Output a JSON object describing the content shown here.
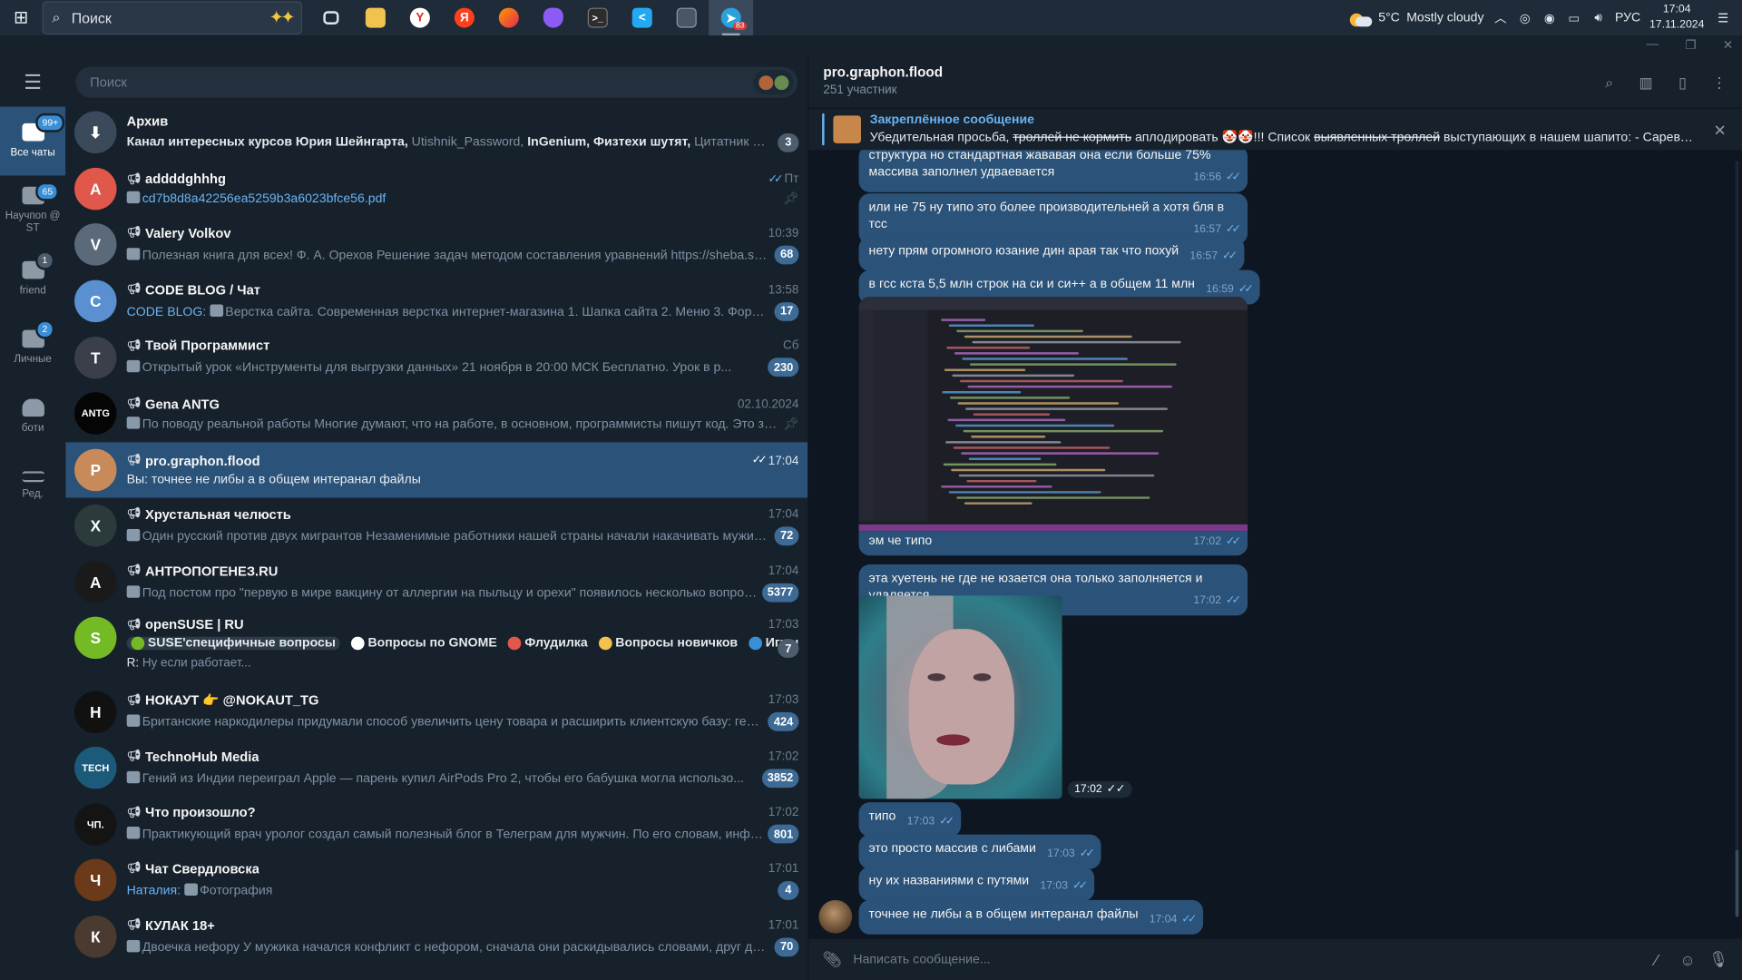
{
  "taskbar": {
    "search_placeholder": "Поиск",
    "weather_temp": "5°C",
    "weather_text": "Mostly cloudy",
    "lang": "РУС",
    "time": "17:04",
    "date": "17.11.2024",
    "weather_badge": "1",
    "telegram_badge": "83"
  },
  "folders": [
    {
      "label": "Все чаты",
      "badge": "99+"
    },
    {
      "label": "Научпоп @ ST",
      "badge": "65"
    },
    {
      "label": "friend",
      "badge": "1"
    },
    {
      "label": "Личные",
      "badge": "2"
    },
    {
      "label": "боти",
      "badge": ""
    },
    {
      "label": "Ред.",
      "badge": ""
    }
  ],
  "chatlist": {
    "search_placeholder": "Поиск",
    "archive": {
      "name": "Архив",
      "preview_bold": "Канал интересных курсов Юрия Шейнгарта,",
      "preview_rest": " Utishnik_Password, ",
      "preview_b2": "InGenium,",
      "preview_b3": " Физтехи шутят,",
      "preview_tail": " Цитатник SciTopus, ...",
      "count": "3"
    },
    "chats": [
      {
        "name": "addddghhhg",
        "time": "Пт",
        "preview": "cd7b8d8a42256ea5259b3a6023bfce56.pdf",
        "count": "",
        "color": "#e0574b",
        "initial": "A"
      },
      {
        "name": "Valery Volkov",
        "time": "10:39",
        "preview": "Полезная книга для всех! Ф. А. Орехов Решение задач методом составления уравнений https://sheba.spb.ru/shkola/resh...",
        "count": "68",
        "color": "#5a6a7a",
        "initial": "V"
      },
      {
        "name": "CODE BLOG / Чат",
        "time": "13:58",
        "sender": "CODE BLOG:",
        "preview": "Верстка сайта. Современная верстка интернет-магазина 1. Шапка сайта 2. Меню 3. Форма по...",
        "count": "17",
        "color": "#5a8fd0",
        "initial": "C"
      },
      {
        "name": "Твой Программист",
        "time": "Сб",
        "preview": "Открытый урок «Инструменты для выгрузки данных»  21 ноября в 20:00 МСК  Бесплатно. Урок в р...",
        "count": "230",
        "color": "#3a3f4a",
        "initial": "Т"
      },
      {
        "name": "Gena ANTG",
        "time": "02.10.2024",
        "preview": "По поводу реальной работы  Многие думают, что на работе, в основном, программисты пишут код. Это заб...",
        "count": "",
        "color": "#050505",
        "initial": "ANTG"
      },
      {
        "name": "pro.graphon.flood",
        "time": "17:04",
        "preview": "Вы: точнее не либы а в общем интеранал файлы",
        "count": "",
        "color": "#c98a5a",
        "initial": "P"
      },
      {
        "name": "Хрустальная челюсть",
        "time": "17:04",
        "preview": "Один русский против двух мигрантов  Незаменимые работники нашей страны начали накачивать мужика, ...",
        "count": "72",
        "color": "#2b3a3a",
        "initial": "Х"
      },
      {
        "name": "АНТРОПОГЕНЕЗ.RU",
        "time": "17:04",
        "preview": "Под постом про \"первую в мире вакцину от аллергии на пыльцу и орехи\" появилось несколько вопросов...",
        "count": "5377",
        "color": "#1a1a1a",
        "initial": "А"
      },
      {
        "name": "openSUSE | RU",
        "time": "17:03",
        "topics": [
          "SUSE'специфичные вопросы",
          "Вопросы по GNOME",
          "Флудилка",
          "Вопросы новичков",
          "Игры",
          "..."
        ],
        "sub_sender": "R:",
        "sub_text": "Ну если работает...",
        "count": "7",
        "color": "#73ba25",
        "initial": "S"
      },
      {
        "name": "НОКАУТ 👉 @NOKAUT_TG",
        "time": "17:03",
        "preview": "Британские наркодилеры придумали способ увеличить цену товара и расширить клиентскую базу: ген...",
        "count": "424",
        "color": "#111",
        "initial": "Н"
      },
      {
        "name": "TechnoHub Media",
        "time": "17:02",
        "preview": "Гений из Индии переиграл Apple — парень купил AirPods Pro 2, чтобы его бабушка могла использо...",
        "count": "3852",
        "color": "#1c5a7a",
        "initial": "TECH"
      },
      {
        "name": "Что произошло?",
        "time": "17:02",
        "preview": "Практикующий врач уролог создал самый полезный блог в Телеграм для мужчин.  По его словам, информ...",
        "count": "801",
        "color": "#141414",
        "initial": "ЧП."
      },
      {
        "name": "Чат Свердловска",
        "time": "17:01",
        "sender": "Наталия:",
        "preview": "Фотография",
        "count": "4",
        "color": "#6a3a1a",
        "initial": "Ч"
      },
      {
        "name": "КУЛАК 18+",
        "time": "17:01",
        "preview": "Двоечка нефору  У мужика начался конфликт с нефором, сначала они раскидывались словами, друг друга о...",
        "count": "70",
        "color": "#4a3a30",
        "initial": "К"
      }
    ]
  },
  "conversation": {
    "title": "pro.graphon.flood",
    "subtitle": "251 участник",
    "pinned_title": "Закреплённое сообщение",
    "pinned_a": "Убедительная просьба, ",
    "pinned_s1": "троллей не кормить",
    "pinned_b": " аплодировать 🤡🤡!!! Список ",
    "pinned_s2": "выявленных троллей",
    "pinned_c": " выступающих в нашем шапито: - Саревок - К...",
    "composer_placeholder": "Написать сообщение...",
    "messages": [
      {
        "text": "структура но стандартная жававая она если больше 75% массива заполнел удваевается",
        "time": "16:56"
      },
      {
        "text": "или не 75 ну типо это более производительней а хотя бля в тсс",
        "time": "16:57"
      },
      {
        "text": "нету прям огромного юзание дин арая так что похуй",
        "time": "16:57"
      },
      {
        "text": "в гсс кста 5,5 млн строк на си и си++ а в общем 11 млн",
        "time": "16:59"
      },
      {
        "text": "эм че типо",
        "time": "17:02"
      },
      {
        "text": "эта хуетень не где не юзается она только заполняется и удаляется",
        "time": "17:02"
      },
      {
        "text": "",
        "time": "17:02"
      },
      {
        "text": "типо",
        "time": "17:03"
      },
      {
        "text": "это просто массив с либами",
        "time": "17:03"
      },
      {
        "text": "ну их названиями с путями",
        "time": "17:03"
      },
      {
        "text": "точнее не либы а в общем интеранал файлы",
        "time": "17:04"
      }
    ]
  }
}
